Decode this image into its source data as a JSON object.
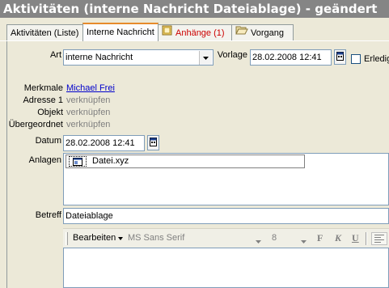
{
  "window": {
    "title": "Aktivitäten (interne Nachricht Dateiablage) - geändert"
  },
  "tabs": [
    {
      "label": "Aktivitäten (Liste)"
    },
    {
      "label": "Interne Nachricht"
    },
    {
      "label": "Anhänge (1)"
    },
    {
      "label": "Vorgang"
    }
  ],
  "form": {
    "art_label": "Art",
    "art_value": "interne Nachricht",
    "vorlage_label": "Vorlage",
    "vorlage_value": "28.02.2008 12:41",
    "erledigt_label": "Erledig",
    "merkmale_label": "Merkmale",
    "merkmale_value": "Michael Frei",
    "adresse_label": "Adresse 1",
    "adresse_value": "verknüpfen",
    "objekt_label": "Objekt",
    "objekt_value": "verknüpfen",
    "uebergeordnet_label": "Übergeordnet",
    "uebergeordnet_value": "verknüpfen",
    "datum_label": "Datum",
    "datum_value": "28.02.2008 12:41",
    "anlagen_label": "Anlagen",
    "anlagen_file": "Datei.xyz",
    "betreff_label": "Betreff",
    "betreff_value": "Dateiablage"
  },
  "editor_toolbar": {
    "bearbeiten_label": "Bearbeiten",
    "font_value": "MS Sans Serif",
    "size_value": "8",
    "bold_label": "F",
    "italic_label": "K",
    "underline_label": "U"
  },
  "colors": {
    "titlebar": "#858585",
    "tab_active_accent": "#e68b2c",
    "attachment_tab_text": "#cc0000",
    "link": "#0000cc"
  }
}
